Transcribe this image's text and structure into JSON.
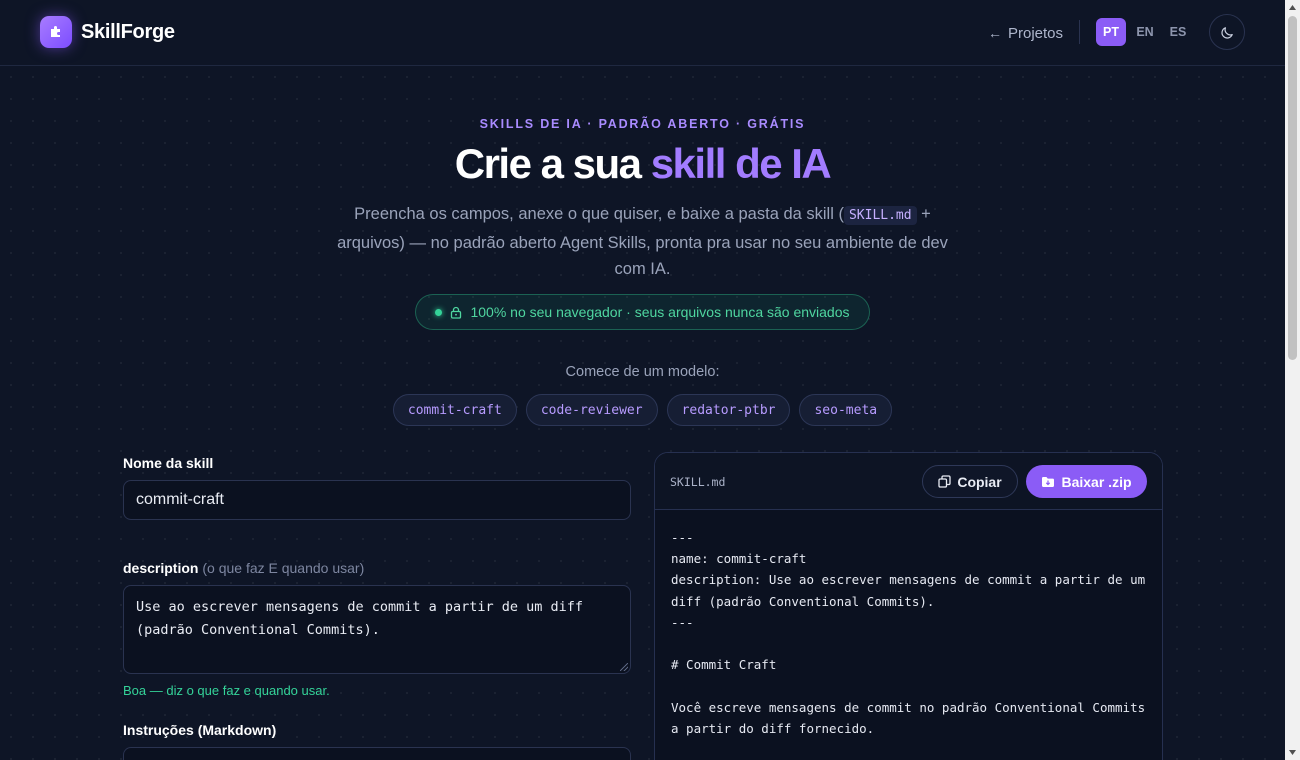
{
  "header": {
    "brand": "SkillForge",
    "projects_link": "Projetos",
    "languages": [
      "PT",
      "EN",
      "ES"
    ],
    "active_language": "PT"
  },
  "hero": {
    "eyebrow": "SKILLS DE IA · PADRÃO ABERTO · GRÁTIS",
    "title_prefix": "Crie a sua ",
    "title_accent": "skill de IA",
    "subtitle_before": "Preencha os campos, anexe o que quiser, e baixe a pasta da skill (",
    "subtitle_code": "SKILL.md",
    "subtitle_after": " + arquivos) — no padrão aberto Agent Skills, pronta pra usar no seu ambiente de dev com IA.",
    "privacy_badge": "100% no seu navegador · seus arquivos nunca são enviados"
  },
  "templates": {
    "label": "Comece de um modelo:",
    "items": [
      "commit-craft",
      "code-reviewer",
      "redator-ptbr",
      "seo-meta"
    ]
  },
  "form": {
    "name_label": "Nome da skill",
    "name_value": "commit-craft",
    "description_label": "description",
    "description_hint": "(o que faz E quando usar)",
    "description_value": "Use ao escrever mensagens de commit a partir de um diff (padrão Conventional Commits).",
    "description_feedback": "Boa — diz o que faz e quando usar.",
    "instructions_label": "Instruções (Markdown)"
  },
  "preview": {
    "filename": "SKILL.md",
    "copy_label": "Copiar",
    "download_label": "Baixar .zip",
    "content": "---\nname: commit-craft\ndescription: Use ao escrever mensagens de commit a partir de um diff (padrão Conventional Commits).\n---\n\n# Commit Craft\n\nVocê escreve mensagens de commit no padrão Conventional Commits a partir do diff fornecido."
  },
  "colors": {
    "background": "#0e1526",
    "accent": "#8b5cf6",
    "accent_text": "#a27cff",
    "success": "#34d399"
  }
}
